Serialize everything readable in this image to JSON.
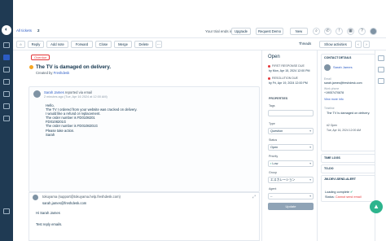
{
  "header": {
    "breadcrumb": "All tickets",
    "ticket_count": "2",
    "trial_text": "Your trial ends in 14 days",
    "upgrade": "Upgrade",
    "request_demo": "Request Demo",
    "new": "New"
  },
  "toolbar": {
    "reply": "Reply",
    "add_note": "Add note",
    "forward": "Forward",
    "close": "Close",
    "merge": "Merge",
    "delete": "Delete",
    "threads": "Threads",
    "show_activities": "Show activities"
  },
  "ticket": {
    "tag": "Overdue",
    "subject": "The TV is damaged on delivery.",
    "created_by_prefix": "Created by",
    "created_by": "Freshdesk"
  },
  "message": {
    "author": "Sarah James",
    "reported": "reported via email",
    "time": "2 minutes ago (Tue, Apr 16 2024 at 12:00 AM)",
    "body": "Hello,\nThe TV I ordered from your website was cracked on delivery.\nI would like a refund or replacement.\nThe order number is FD0108201\nFD0108201G\nThe order number is FD0108201G\nPlease take action.\nSarah"
  },
  "reply": {
    "from_label": "From",
    "from": "tokuyama (support@tokuyama.help.freshdesk.com)",
    "to_label": "To",
    "to": "sarah.james@freshdesk.com",
    "greeting": "Hi Sarah James",
    "text": "Test reply emails."
  },
  "properties": {
    "status": "Open",
    "first_response_label": "FIRST RESPONSE DUE",
    "first_response_by": "by Mon, Apr 15, 2024 12:00 PM",
    "first_response_edit": "Edit",
    "resolution_label": "RESOLUTION DUE",
    "resolution_by": "by Fri, Apr 19, 2024 12:00 PM",
    "resolution_edit": "Edit",
    "section": "PROPERTIES",
    "tags_label": "Tags",
    "type_label": "Type",
    "type_value": "Question",
    "status_label": "Status",
    "status_value": "Open",
    "priority_label": "Priority",
    "priority_value": "Low",
    "group_label": "Group",
    "group_value": "エスカレーション",
    "agent_label": "Agent",
    "agent_value": "--",
    "update": "Update"
  },
  "contact": {
    "header": "CONTACT DETAILS",
    "name": "Sarah James",
    "email_label": "Email",
    "email": "sarah.james@freshdesk.com",
    "phone_label": "Work phone",
    "phone": "+19057470878",
    "view_more": "View more info",
    "timeline_label": "Timeline",
    "timeline_item": "The TV is damaged on delivery.",
    "timeline_meta": "#2 Open",
    "timeline_date": "Tue, Apr 16, 2024 12:00 AM"
  },
  "widgets": {
    "time_logs": "TIME LOGS",
    "todo": "TO-DO",
    "devi_alert": "JM-DEVI-SEND-ALERT",
    "loading": "Loading complete",
    "status_label": "Status:",
    "status_value": "Cannot send email"
  }
}
